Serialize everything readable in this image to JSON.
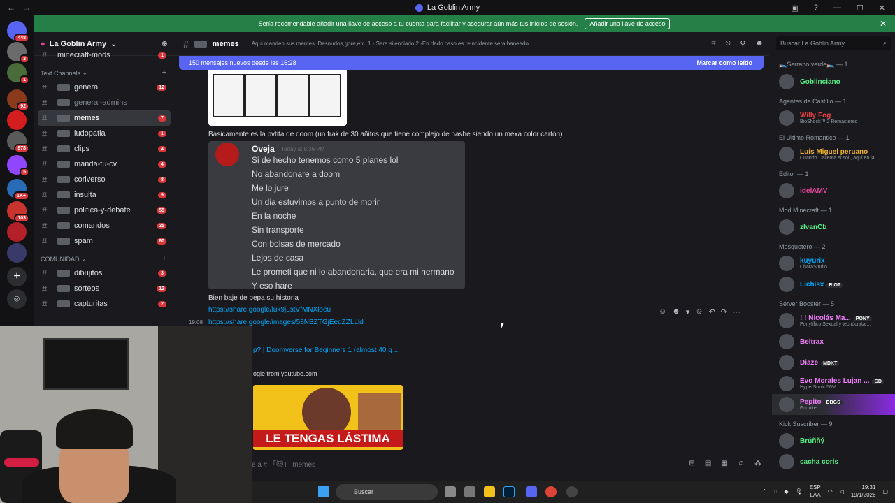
{
  "app": {
    "title": "La Goblin Army"
  },
  "banner": {
    "text": "Sería recomendable añadir una llave de acceso a tu cuenta para facilitar y asegurar aún más tus inicios de sesión.",
    "button": "Añadir una llave de acceso"
  },
  "guilds": [
    {
      "badge": "448"
    },
    {
      "badge": "3"
    },
    {
      "badge": "1"
    },
    {
      "badge": "92"
    },
    {
      "badge": ""
    },
    {
      "badge": "978"
    },
    {
      "badge": "5"
    },
    {
      "badge": "1K+"
    },
    {
      "badge": "103"
    },
    {
      "badge": ""
    },
    {
      "badge": ""
    }
  ],
  "server": {
    "name": "La Goblin Army"
  },
  "channels_top": {
    "name": "minecraft-mods",
    "count": "1"
  },
  "category1": "Text Channels",
  "channels": [
    {
      "name": "general",
      "count": "12"
    },
    {
      "name": "general-admins",
      "count": ""
    },
    {
      "name": "memes",
      "count": "7"
    },
    {
      "name": "ludopatia",
      "count": "1"
    },
    {
      "name": "clips",
      "count": "4"
    },
    {
      "name": "manda-tu-cv",
      "count": "4"
    },
    {
      "name": "coriverso",
      "count": "8"
    },
    {
      "name": "insulta",
      "count": "9"
    },
    {
      "name": "politica-y-debate",
      "count": "55"
    },
    {
      "name": "comandos",
      "count": "25"
    },
    {
      "name": "spam",
      "count": "60"
    }
  ],
  "category2": "COMUNIDAD",
  "channels2": [
    {
      "name": "dibujitos",
      "count": "3"
    },
    {
      "name": "sorteos",
      "count": "12"
    },
    {
      "name": "capturitas",
      "count": "2"
    }
  ],
  "header": {
    "channel": "memes",
    "topic": "Aqui manden sus memes. Desnudos,gore,etc. 1.- Sera silenciado 2.-En dado caso es reincidente sera baneado"
  },
  "search_placeholder": "Buscar La Goblin Army",
  "newmsg": {
    "text": "150 mensajes nuevos desde las 16:28",
    "action": "Marcar como leído"
  },
  "messages": {
    "text1": "Básicamente es la pvtita de doom (un frak de 30 añitos que tiene complejo de nashe siendo un mexa color cartón)",
    "shot_name": "Oveja",
    "shot_time": "Today at 8:36 PM",
    "shot_lines": [
      "Si de hecho tenemos como 5 planes lol",
      "No abandonare a doom",
      "Me lo jure",
      "Un dia estuvimos a punto de morir",
      "En la noche",
      "Sin transporte",
      "Con bolsas de mercado",
      "Lejos de casa",
      "Le prometi que ni lo abandonaria, que era mi hermano",
      "Y eso hare"
    ],
    "text2": "Bien baje de pepa su historia",
    "link1": "https://share.google/luk9jLstVfMNXloeu",
    "link2": "https://share.google/images/58NBZTGjEeqZZLLld",
    "time": "19:08",
    "embed_title": "p? | Doomverse for Beginners 1 (almost 40 g ...",
    "embed_sub": "ogle from youtube.com",
    "thumb_caption": "LE TENGAS LÁSTIMA"
  },
  "composer": "e a # 「🐱」 memes",
  "members": [
    {
      "role": "🛌Serrano verde🛌 — 1"
    },
    {
      "name": "Goblinciano",
      "status": "",
      "tag": "",
      "color": "#57f287"
    },
    {
      "role": "Agentes de Castillo — 1"
    },
    {
      "name": "Willy Fog",
      "status": "BioShock™ 2 Remastered",
      "tag": "",
      "color": "#ed4245"
    },
    {
      "role": "El Ultimo Romantico — 1"
    },
    {
      "name": "Luis Miguel peruano",
      "status": "Cuando Calienta el sol , aqui en la ...",
      "tag": "",
      "color": "#f0b232"
    },
    {
      "role": "Editor — 1"
    },
    {
      "name": "idelAMV",
      "status": "",
      "tag": "",
      "color": "#eb459e"
    },
    {
      "role": "Mod Minecraft — 1"
    },
    {
      "name": "zlvanCb",
      "status": "",
      "tag": "",
      "color": "#57f287"
    },
    {
      "role": "Mosquetero — 2"
    },
    {
      "name": "kuyurix",
      "status": "CharaStudio",
      "tag": "",
      "color": "#00a8fc"
    },
    {
      "name": "Lichisx",
      "status": "",
      "tag": "RIOT",
      "color": "#00a8fc"
    },
    {
      "role": "Server Booster — 5"
    },
    {
      "name": "! ! Nicolás Ma...",
      "status": "Ponyfílico Sexual y tecnócrata ...",
      "tag": "PONY",
      "color": "#f47fff"
    },
    {
      "name": "Beltrax",
      "status": "",
      "tag": "",
      "color": "#f47fff"
    },
    {
      "name": "Diaze",
      "status": "",
      "tag": "MDKT",
      "color": "#f47fff"
    },
    {
      "name": "Evo Morales Lujan ...",
      "status": "HyperSonic 56%",
      "tag": "GD",
      "color": "#f47fff"
    },
    {
      "name": "Pepito",
      "status": "Fortnite",
      "tag": "DBGS",
      "color": "#f47fff"
    },
    {
      "role": "Kick Suscriber — 9"
    },
    {
      "name": "Brúññý",
      "status": "",
      "tag": "",
      "color": "#57f287"
    },
    {
      "name": "cacha coris",
      "status": "",
      "tag": "",
      "color": "#57f287"
    }
  ],
  "taskbar": {
    "search": "Buscar",
    "lang": "ESP",
    "lang2": "LAA",
    "time": "19:31",
    "date": "19/1/2026"
  }
}
